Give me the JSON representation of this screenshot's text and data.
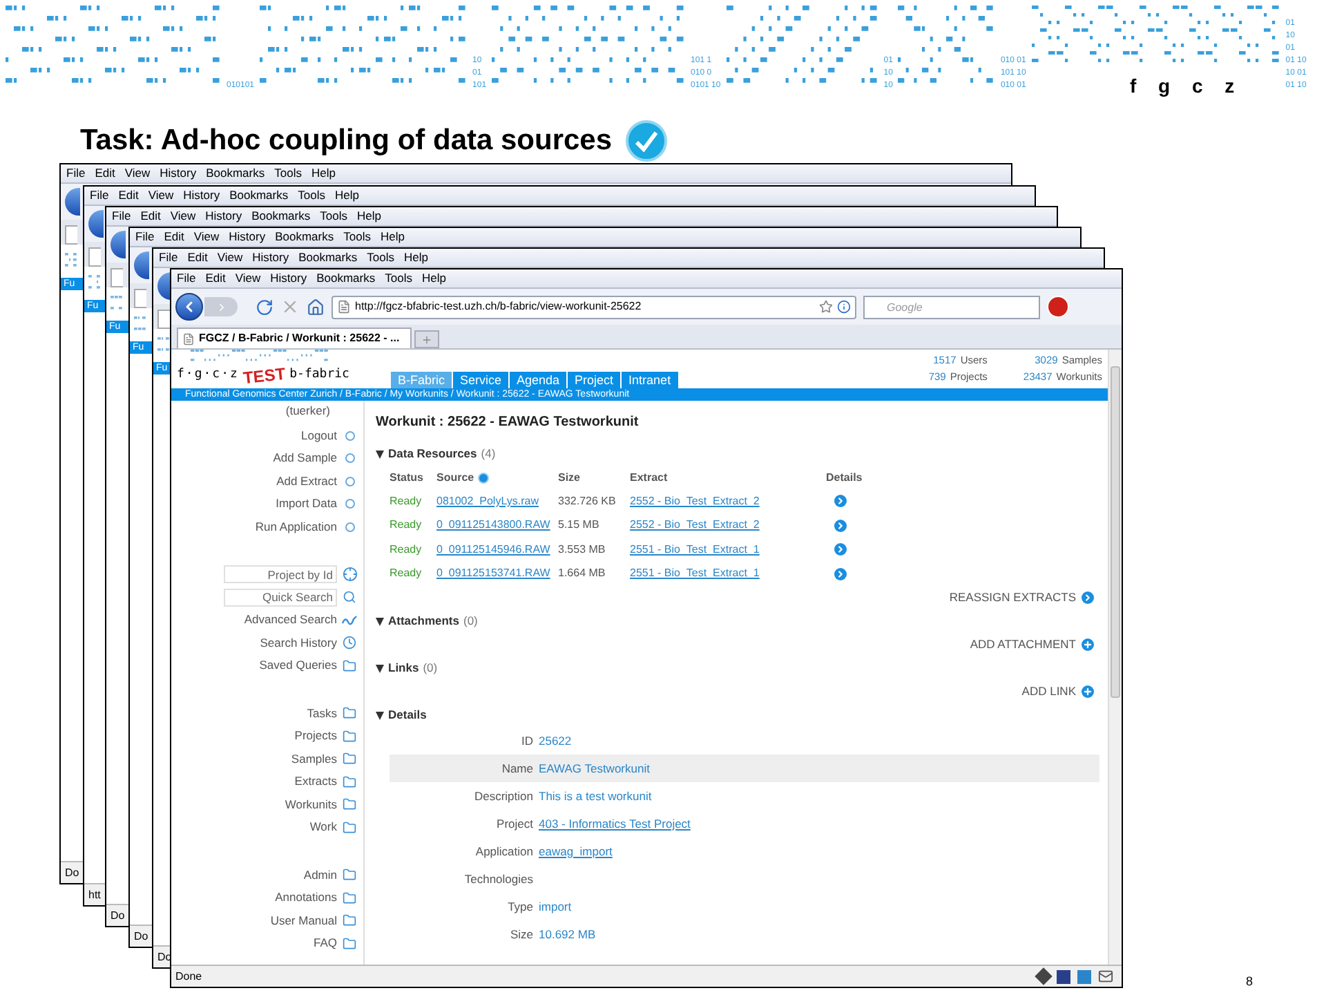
{
  "slide": {
    "banner_digits": [
      {
        "lines": [
          "010101"
        ]
      },
      {
        "lines": [
          "10",
          "01",
          "101"
        ]
      },
      {
        "lines": [
          "101 1",
          "010 0",
          "0101 10"
        ]
      },
      {
        "lines": [
          "01",
          "10",
          "10"
        ]
      },
      {
        "lines": [
          "010 01",
          "101 10",
          "010 01"
        ]
      },
      {
        "lines": [
          "01",
          "10",
          "01",
          "01 10",
          "10 01",
          "01 10"
        ]
      }
    ],
    "logo": "f g c z",
    "title": "Task: Ad-hoc coupling of data sources",
    "page_number": "8"
  },
  "back_windows": [
    {
      "menu": [
        "File",
        "Edit",
        "View",
        "History",
        "Bookmarks",
        "Tools",
        "Help"
      ],
      "bar_text": "Fu",
      "status": "Do"
    },
    {
      "menu": [
        "File",
        "Edit",
        "View",
        "History",
        "Bookmarks",
        "Tools",
        "Help"
      ],
      "bar_text": "Fu",
      "status": "htt"
    },
    {
      "menu": [
        "File",
        "Edit",
        "View",
        "History",
        "Bookmarks",
        "Tools",
        "Help"
      ],
      "bar_text": "Fu",
      "status": "Do"
    },
    {
      "menu": [
        "File",
        "Edit",
        "View",
        "History",
        "Bookmarks",
        "Tools",
        "Help"
      ],
      "bar_text": "Fu",
      "status": "Do"
    },
    {
      "menu": [
        "File",
        "Edit",
        "View",
        "History",
        "Bookmarks",
        "Tools",
        "Help"
      ],
      "bar_text": "Fu",
      "status": "Do"
    }
  ],
  "browser": {
    "menu": [
      "File",
      "Edit",
      "View",
      "History",
      "Bookmarks",
      "Tools",
      "Help"
    ],
    "url": "http://fgcz-bfabric-test.uzh.ch/b-fabric/view-workunit-25622",
    "search_placeholder": "Google",
    "tab": "FGCZ / B-Fabric / Workunit : 25622 - ...",
    "status": "Done"
  },
  "site": {
    "logo": "f·g·c·z",
    "stamp": "TEST",
    "brand": "b-fabric",
    "nav": [
      {
        "label": "B-Fabric",
        "selected": true
      },
      {
        "label": "Service",
        "selected": false
      },
      {
        "label": "Agenda",
        "selected": false
      },
      {
        "label": "Project",
        "selected": false
      },
      {
        "label": "Intranet",
        "selected": false
      }
    ],
    "stats": [
      {
        "value": "1517",
        "label": "Users"
      },
      {
        "value": "3029",
        "label": "Samples"
      },
      {
        "value": "739",
        "label": "Projects"
      },
      {
        "value": "23437",
        "label": "Workunits"
      }
    ],
    "breadcrumb": "Functional Genomics Center Zurich / B-Fabric / My Workunits / Workunit : 25622 - EAWAG Testworkunit"
  },
  "sidebar": {
    "user": "(tuerker)",
    "groups": [
      {
        "items": [
          {
            "label": "Logout",
            "kind": "action"
          },
          {
            "label": "Add Sample",
            "kind": "action"
          },
          {
            "label": "Add Extract",
            "kind": "action"
          },
          {
            "label": "Import Data",
            "kind": "action"
          },
          {
            "label": "Run Application",
            "kind": "action"
          }
        ]
      },
      {
        "items": [
          {
            "placeholder": "Project by Id",
            "kind": "id-input"
          },
          {
            "placeholder": "Quick Search",
            "kind": "search-input"
          },
          {
            "label": "Advanced Search",
            "kind": "advanced"
          },
          {
            "label": "Search History",
            "kind": "history"
          },
          {
            "label": "Saved Queries",
            "kind": "folder"
          }
        ]
      },
      {
        "items": [
          {
            "label": "Tasks",
            "kind": "folder"
          },
          {
            "label": "Projects",
            "kind": "folder"
          },
          {
            "label": "Samples",
            "kind": "folder"
          },
          {
            "label": "Extracts",
            "kind": "folder"
          },
          {
            "label": "Workunits",
            "kind": "folder"
          },
          {
            "label": "Work",
            "kind": "folder"
          }
        ]
      },
      {
        "items": [
          {
            "label": "Admin",
            "kind": "folder"
          },
          {
            "label": "Annotations",
            "kind": "folder"
          },
          {
            "label": "User Manual",
            "kind": "folder"
          },
          {
            "label": "FAQ",
            "kind": "folder"
          }
        ]
      }
    ]
  },
  "main": {
    "title": "Workunit : 25622 - EAWAG Testworkunit",
    "data_resources": {
      "title": "Data Resources",
      "count": "(4)",
      "expanded": true,
      "columns": [
        "Status",
        "Source",
        "Size",
        "Extract",
        "Details"
      ],
      "rows": [
        {
          "status": "Ready",
          "source": "081002_PolyLys.raw",
          "size": "332.726 KB",
          "extract": "2552 - Bio_Test_Extract_2"
        },
        {
          "status": "Ready",
          "source": "0_091125143800.RAW",
          "size": "5.15 MB",
          "extract": "2552 - Bio_Test_Extract_2"
        },
        {
          "status": "Ready",
          "source": "0_091125145946.RAW",
          "size": "3.553 MB",
          "extract": "2551 - Bio_Test_Extract_1"
        },
        {
          "status": "Ready",
          "source": "0_091125153741.RAW",
          "size": "1.664 MB",
          "extract": "2551 - Bio_Test_Extract_1"
        }
      ],
      "action": "REASSIGN EXTRACTS"
    },
    "attachments": {
      "title": "Attachments",
      "count": "(0)",
      "expanded": true,
      "action": "ADD ATTACHMENT"
    },
    "links": {
      "title": "Links",
      "count": "(0)",
      "expanded": true,
      "action": "ADD LINK"
    },
    "details": {
      "title": "Details",
      "expanded": true,
      "fields": [
        {
          "label": "ID",
          "value": "25622",
          "link": false,
          "highlighted": false
        },
        {
          "label": "Name",
          "value": "EAWAG Testworkunit",
          "link": false,
          "highlighted": true
        },
        {
          "label": "Description",
          "value": "This is a test workunit",
          "link": false,
          "highlighted": false
        },
        {
          "label": "Project",
          "value": "403 - Informatics Test Project",
          "link": true,
          "highlighted": false
        },
        {
          "label": "Application",
          "value": "eawag_import",
          "link": true,
          "highlighted": false
        },
        {
          "label": "Technologies",
          "highlighted": false
        },
        {
          "label": "Type",
          "value": "import",
          "link": false,
          "highlighted": false
        },
        {
          "label": "Size",
          "value": "10.692 MB",
          "link": false,
          "highlighted": false
        }
      ]
    }
  }
}
